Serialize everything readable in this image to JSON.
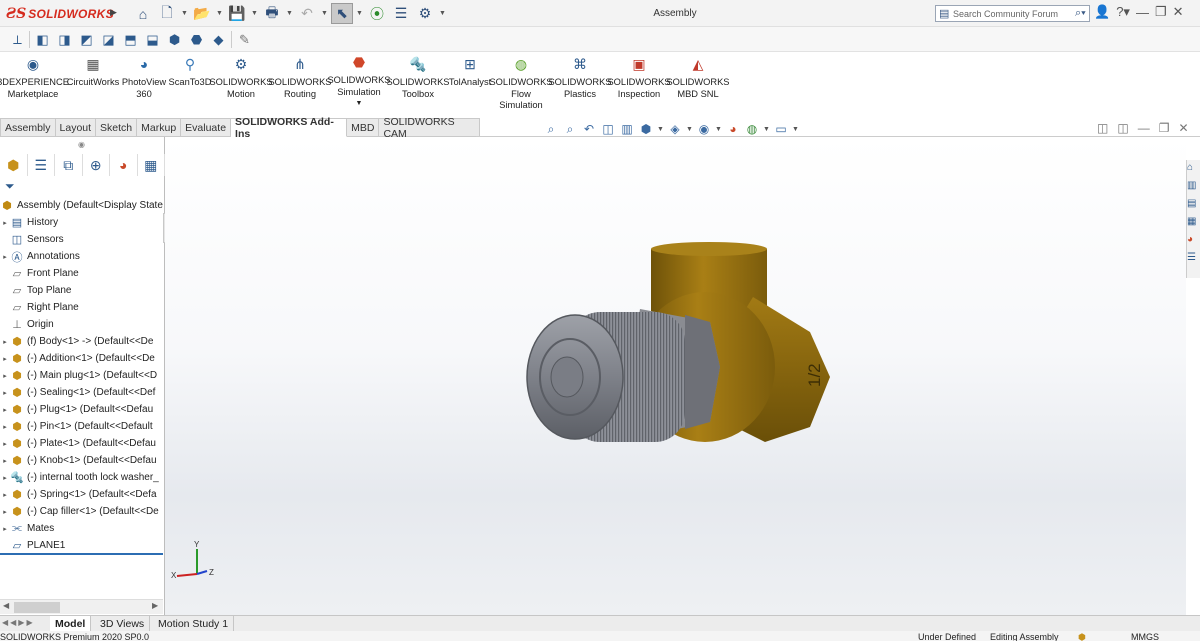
{
  "titlebar": {
    "logo_text": "SOLIDWORKS",
    "doc_title": "Assembly",
    "search_placeholder": "Search Community Forum"
  },
  "command_manager": {
    "items": [
      {
        "label_1": "3DEXPERIENCE",
        "label_2": "Marketplace",
        "icon": "marketplace-icon"
      },
      {
        "label_1": "CircuitWorks",
        "label_2": "",
        "icon": "circuitworks-icon"
      },
      {
        "label_1": "PhotoView",
        "label_2": "360",
        "icon": "photoview-icon"
      },
      {
        "label_1": "ScanTo3D",
        "label_2": "",
        "icon": "scanto3d-icon"
      },
      {
        "label_1": "SOLIDWORKS",
        "label_2": "Motion",
        "icon": "motion-icon"
      },
      {
        "label_1": "SOLIDWORKS",
        "label_2": "Routing",
        "icon": "routing-icon"
      },
      {
        "label_1": "SOLIDWORKS",
        "label_2": "Simulation",
        "icon": "simulation-icon"
      },
      {
        "label_1": "SOLIDWORKS",
        "label_2": "Toolbox",
        "icon": "toolbox-icon"
      },
      {
        "label_1": "TolAnalyst",
        "label_2": "",
        "icon": "tolanalyst-icon"
      },
      {
        "label_1": "SOLIDWORKS",
        "label_2": "Flow",
        "label_3": "Simulation",
        "icon": "flow-simulation-icon"
      },
      {
        "label_1": "SOLIDWORKS",
        "label_2": "Plastics",
        "icon": "plastics-icon"
      },
      {
        "label_1": "SOLIDWORKS",
        "label_2": "Inspection",
        "icon": "inspection-icon"
      },
      {
        "label_1": "SOLIDWORKS",
        "label_2": "MBD SNL",
        "icon": "mbd-snl-icon"
      }
    ]
  },
  "tabs": [
    "Assembly",
    "Layout",
    "Sketch",
    "Markup",
    "Evaluate",
    "SOLIDWORKS Add-Ins",
    "MBD",
    "SOLIDWORKS CAM"
  ],
  "active_tab": "SOLIDWORKS Add-Ins",
  "tree": {
    "root": "Assembly  (Default<Display State",
    "items": [
      {
        "label": "History",
        "icon": "history-icon"
      },
      {
        "label": "Sensors",
        "icon": "sensors-icon"
      },
      {
        "label": "Annotations",
        "icon": "annotations-icon"
      },
      {
        "label": "Front Plane",
        "icon": "plane-icon"
      },
      {
        "label": "Top Plane",
        "icon": "plane-icon"
      },
      {
        "label": "Right Plane",
        "icon": "plane-icon"
      },
      {
        "label": "Origin",
        "icon": "origin-icon"
      },
      {
        "label": "(f) Body<1> -> (Default<<De",
        "icon": "part-icon"
      },
      {
        "label": "(-) Addition<1> (Default<<De",
        "icon": "part-icon"
      },
      {
        "label": "(-) Main plug<1> (Default<<D",
        "icon": "part-icon"
      },
      {
        "label": "(-) Sealing<1> (Default<<Def",
        "icon": "part-icon"
      },
      {
        "label": "(-) Plug<1> (Default<<Defau",
        "icon": "part-icon"
      },
      {
        "label": "(-) Pin<1> (Default<<Default",
        "icon": "part-icon"
      },
      {
        "label": "(-) Plate<1> (Default<<Defau",
        "icon": "part-icon"
      },
      {
        "label": "(-) Knob<1> (Default<<Defau",
        "icon": "part-icon"
      },
      {
        "label": "(-) internal tooth lock washer_",
        "icon": "toolbox-part-icon"
      },
      {
        "label": "(-) Spring<1> (Default<<Defa",
        "icon": "part-icon"
      },
      {
        "label": "(-) Cap filler<1> (Default<<De",
        "icon": "part-icon"
      },
      {
        "label": "Mates",
        "icon": "mates-icon"
      },
      {
        "label": "PLANE1",
        "icon": "plane-icon"
      }
    ]
  },
  "model": {
    "marking": "1/2",
    "colors": {
      "brass": "#a77d14",
      "steel": "#8a8d94"
    }
  },
  "triad": {
    "x": "X",
    "y": "Y",
    "z": "Z"
  },
  "bottom_tabs": [
    "Model",
    "3D Views",
    "Motion Study 1"
  ],
  "status": {
    "product": "SOLIDWORKS Premium 2020 SP0.0",
    "state": "Under Defined",
    "mode": "Editing Assembly",
    "units": "MMGS"
  }
}
